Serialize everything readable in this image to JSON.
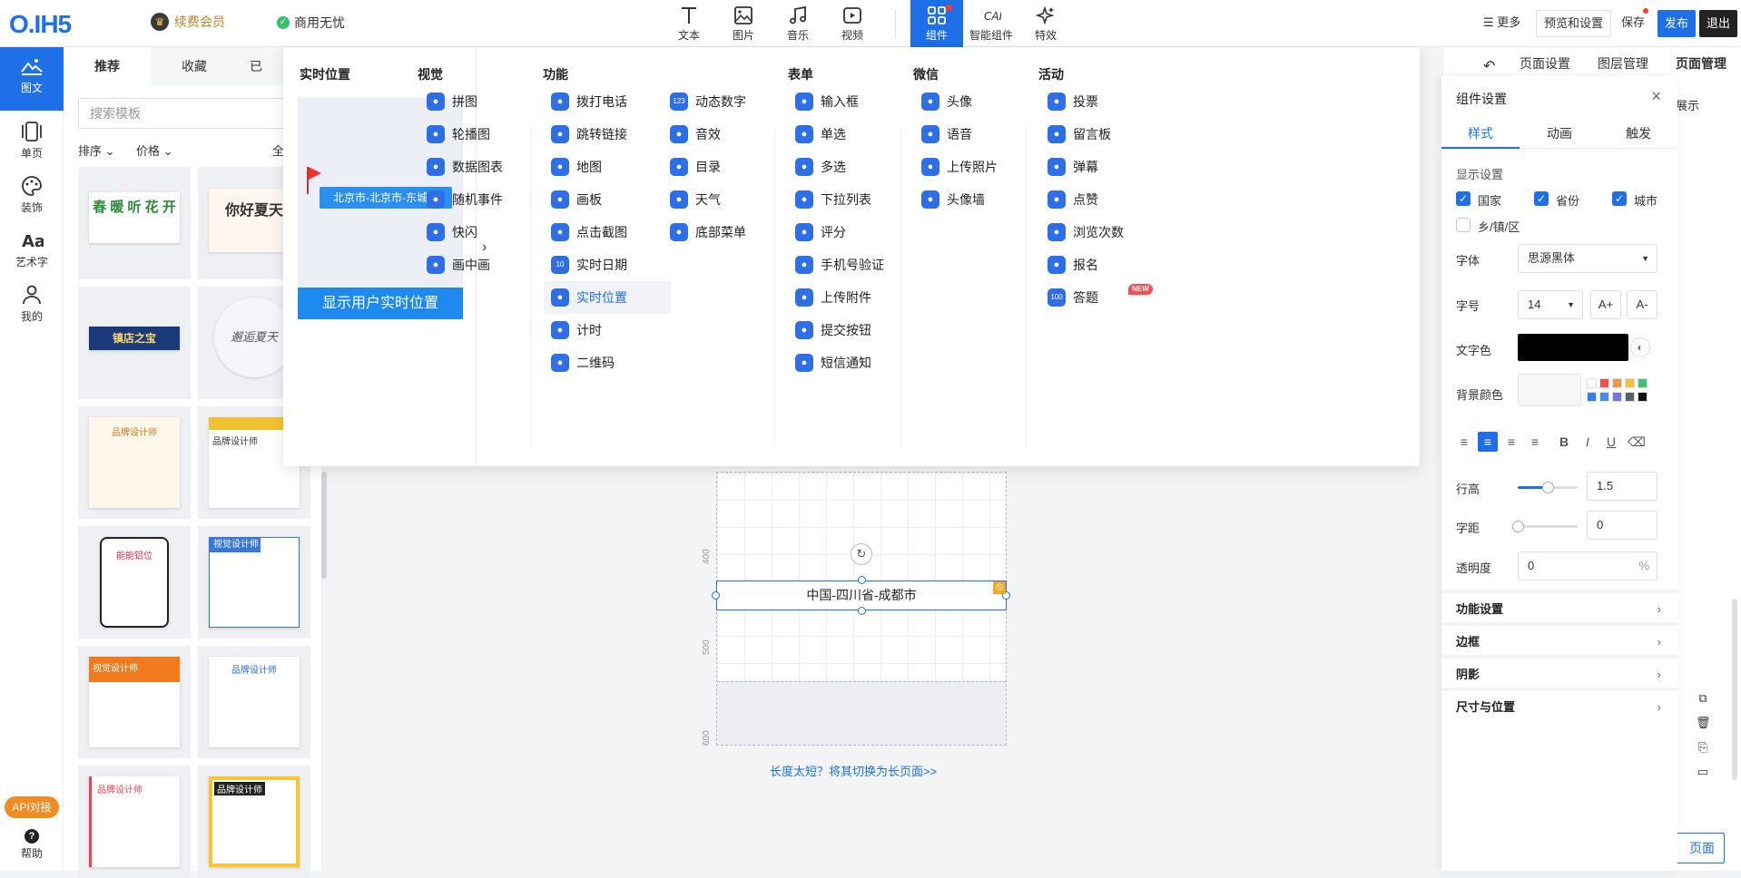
{
  "topbar": {
    "logo": "O.IH5",
    "vip_label": "续费会员",
    "commercial_label": "商用无忧",
    "tools": [
      {
        "label": "文本",
        "icon": "text-icon"
      },
      {
        "label": "图片",
        "icon": "image-icon"
      },
      {
        "label": "音乐",
        "icon": "music-icon"
      },
      {
        "label": "视频",
        "icon": "video-icon"
      },
      {
        "label": "组件",
        "icon": "component-icon"
      },
      {
        "label": "智能组件",
        "icon": "ai-icon"
      },
      {
        "label": "特效",
        "icon": "sparkle-icon"
      }
    ],
    "more_label": "更多",
    "preview_label": "预览和设置",
    "save_label": "保存",
    "publish_label": "发布",
    "exit_label": "退出"
  },
  "rail": {
    "items": [
      {
        "label": "图文",
        "icon": "mountain-icon"
      },
      {
        "label": "单页",
        "icon": "page-icon"
      },
      {
        "label": "装饰",
        "icon": "palette-icon"
      },
      {
        "label": "艺术字",
        "icon": "art-text-icon"
      },
      {
        "label": "我的",
        "icon": "user-icon"
      }
    ],
    "api_label": "API对接",
    "help_label": "帮助"
  },
  "templates": {
    "tabs": [
      "推荐",
      "收藏",
      "已"
    ],
    "search_placeholder": "搜索模板",
    "sort_label": "排序",
    "price_label": "价格",
    "all_label": "全",
    "thumbs": [
      {
        "title": "春 暖 听 花 开"
      },
      {
        "title": "你好夏天"
      },
      {
        "title": "镇店之宝"
      },
      {
        "title": "邂逅夏天"
      },
      {
        "title": "品牌设计师"
      },
      {
        "title": "品牌设计师"
      },
      {
        "title": "能能铝位"
      },
      {
        "title": "视觉设计师"
      },
      {
        "title": "视觉设计师"
      },
      {
        "title": "品牌设计师"
      },
      {
        "title": "品牌设计师"
      },
      {
        "title": "品牌设计师"
      }
    ]
  },
  "canvas": {
    "ruler": [
      "400",
      "500",
      "600"
    ],
    "location_text": "中国-四川省-成都市",
    "switch_link": "长度太短？将其切换为长页面>>"
  },
  "menu": {
    "left_heading": "实时位置",
    "preview_location": "北京市-北京市-东城区",
    "show_button": "显示用户实时位置",
    "columns": [
      {
        "heading": "视觉",
        "items": [
          {
            "label": "拼图",
            "icon": "puzzle-icon"
          },
          {
            "label": "轮播图",
            "icon": "carousel-icon"
          },
          {
            "label": "数据图表",
            "icon": "chart-icon"
          },
          {
            "label": "随机事件",
            "icon": "dice-icon"
          },
          {
            "label": "快闪",
            "icon": "flash-icon"
          },
          {
            "label": "画中画",
            "icon": "pip-icon"
          }
        ]
      },
      {
        "heading": "功能",
        "items": [
          {
            "label": "拨打电话",
            "icon": "phone-icon"
          },
          {
            "label": "跳转链接",
            "icon": "link-icon"
          },
          {
            "label": "地图",
            "icon": "map-icon"
          },
          {
            "label": "画板",
            "icon": "paint-icon"
          },
          {
            "label": "点击截图",
            "icon": "tap-icon"
          },
          {
            "label": "实时日期",
            "icon": "calendar-icon",
            "badge": "10"
          },
          {
            "label": "实时位置",
            "icon": "location-icon"
          },
          {
            "label": "计时",
            "icon": "timer-icon"
          },
          {
            "label": "二维码",
            "icon": "qrcode-icon"
          }
        ]
      },
      {
        "heading": "",
        "items": [
          {
            "label": "动态数字",
            "icon": "number-icon",
            "badge": "123"
          },
          {
            "label": "音效",
            "icon": "sound-icon"
          },
          {
            "label": "目录",
            "icon": "catalog-icon"
          },
          {
            "label": "天气",
            "icon": "weather-icon"
          },
          {
            "label": "底部菜单",
            "icon": "bottom-menu-icon"
          }
        ]
      },
      {
        "heading": "表单",
        "items": [
          {
            "label": "输入框",
            "icon": "input-icon"
          },
          {
            "label": "单选",
            "icon": "radio-icon"
          },
          {
            "label": "多选",
            "icon": "checkbox-icon"
          },
          {
            "label": "下拉列表",
            "icon": "dropdown-icon"
          },
          {
            "label": "评分",
            "icon": "star-icon"
          },
          {
            "label": "手机号验证",
            "icon": "sms-verify-icon"
          },
          {
            "label": "上传附件",
            "icon": "upload-icon"
          },
          {
            "label": "提交按钮",
            "icon": "submit-icon"
          },
          {
            "label": "短信通知",
            "icon": "mail-icon"
          }
        ]
      },
      {
        "heading": "微信",
        "items": [
          {
            "label": "头像",
            "icon": "avatar-icon"
          },
          {
            "label": "语音",
            "icon": "mic-icon"
          },
          {
            "label": "上传照片",
            "icon": "photo-upload-icon"
          },
          {
            "label": "头像墙",
            "icon": "avatar-wall-icon"
          }
        ]
      },
      {
        "heading": "活动",
        "items": [
          {
            "label": "投票",
            "icon": "vote-icon"
          },
          {
            "label": "留言板",
            "icon": "message-icon"
          },
          {
            "label": "弹幕",
            "icon": "danmaku-icon"
          },
          {
            "label": "点赞",
            "icon": "like-icon"
          },
          {
            "label": "浏览次数",
            "icon": "eye-icon"
          },
          {
            "label": "报名",
            "icon": "signup-icon"
          },
          {
            "label": "答题",
            "icon": "quiz-icon",
            "badge": "100",
            "tag": "NEW"
          }
        ]
      }
    ]
  },
  "right": {
    "tabs": [
      "页面设置",
      "图层管理",
      "页面管理"
    ],
    "show_label": "展示",
    "new_page_label": "页面"
  },
  "settings": {
    "title": "组件设置",
    "tabs": [
      "样式",
      "动画",
      "触发"
    ],
    "display_label": "显示设置",
    "checks": [
      {
        "label": "国家",
        "checked": true
      },
      {
        "label": "省份",
        "checked": true
      },
      {
        "label": "城市",
        "checked": true
      },
      {
        "label": "乡/镇/区",
        "checked": false
      }
    ],
    "font_label": "字体",
    "font_value": "思源黑体",
    "size_label": "字号",
    "size_value": "14",
    "size_up": "A+",
    "size_down": "A-",
    "text_color_label": "文字色",
    "text_color": "#000000",
    "bg_color_label": "背景颜色",
    "palette": [
      "#ffffff",
      "#f05050",
      "#f09850",
      "#f0c040",
      "#40c070",
      "#2f80ed",
      "#4a90e2",
      "#7a70e0",
      "#556070",
      "#111111"
    ],
    "line_height_label": "行高",
    "line_height_value": "1.5",
    "line_height_fraction": 0.5,
    "letter_spacing_label": "字距",
    "letter_spacing_value": "0",
    "opacity_label": "透明度",
    "opacity_value": "0",
    "opacity_unit": "%",
    "sections": [
      "功能设置",
      "边框",
      "阴影",
      "尺寸与位置"
    ]
  }
}
